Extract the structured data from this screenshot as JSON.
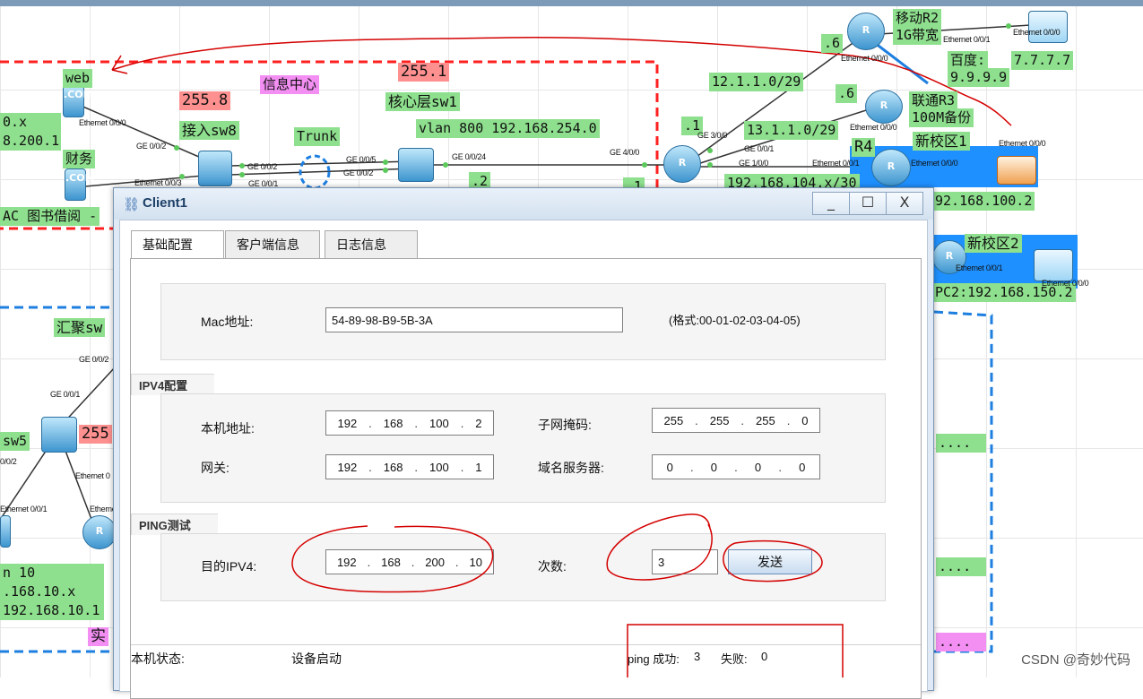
{
  "topology": {
    "labels": {
      "web": "web",
      "caiwu": "财务",
      "ip_left_1": "0.x",
      "ip_left_2": "8.200.1",
      "mask_255_8": "255.8",
      "access_sw8": "接入sw8",
      "trunk": "Trunk",
      "info_center": "信息中心",
      "mask_255_1": "255.1",
      "core_sw1": "核心层sw1",
      "vlan800": "vlan 800 192.168.254.0",
      "net_12": "12.1.1.0/29",
      "net_13": "13.1.1.0/29",
      "dot6_a": ".6",
      "dot6_b": ".6",
      "dot1_a": ".1",
      "dot1_b": ".1",
      "dot2": ".2",
      "net_104": "192.168.104.x/30",
      "mobile_r2": "移动R2",
      "bw_1g": "1G带宽",
      "baidu": "百度:",
      "ip_9999": "9.9.9.9",
      "ip_7777": "7.7.7.7",
      "unicom_r3": "联通R3",
      "backup_100m": "100M备份",
      "r4": "R4",
      "campus1": "新校区1",
      "ip_100_2": "92.168.100.2",
      "campus2": "新校区2",
      "pc2_ip": "PC2:192.168.150.2",
      "library": "AC 图书借阅 -",
      "huiju_sw": "汇聚sw",
      "sw5": "sw5",
      "mask_255_left": "255",
      "vlan10": "n 10",
      "net_10x": ".168.10.x",
      "gw_10_1": "192.168.10.1",
      "shi": "实",
      "dots1": "....",
      "dots2": "....",
      "dots3": "...."
    },
    "ports": {
      "eth000_web": "Ethernet 0/0/0",
      "ge002_a": "GE 0/0/2",
      "eth003": "Ethernet 0/0/3",
      "ge002_b": "GE 0/0/2",
      "ge001_a": "GE 0/0/1",
      "ge005": "GE 0/0/5",
      "ge002_c": "GE 0/0/2",
      "ge0024": "GE 0/0/24",
      "ge400": "GE 4/0/0",
      "ge300": "GE 3/0/0",
      "ge001_b": "GE 0/0/1",
      "ge100": "GE 1/0/0",
      "eth000_r2": "Ethernet 0/0/0",
      "eth001_r2": "Ethernet 0/0/1",
      "eth000_server": "Ethernet 0/0/0",
      "eth000_r3": "Ethernet 0/0/0",
      "eth001_r4": "Ethernet 0/0/1",
      "eth000_r4": "Ethernet 0/0/0",
      "eth000_pc1": "Ethernet 0/0/0",
      "eth001_c2": "Ethernet 0/0/1",
      "eth000_c2": "Ethernet 0/0/0",
      "ge002_sw": "GE 0/0/2",
      "ge001_sw": "GE 0/0/1",
      "eth002_sw5": "0/0/2",
      "eth_sw5": "Ethernet 0",
      "eth001_sw5": "Ethernet 0/0/1",
      "eth_r_left": "Etherne"
    }
  },
  "dialog": {
    "title": "Client1",
    "buttons": {
      "minimize": "_",
      "maximize": "☐",
      "close": "X"
    },
    "tabs": [
      "基础配置",
      "客户端信息",
      "日志信息"
    ],
    "mac": {
      "label": "Mac地址:",
      "value": "54-89-98-B9-5B-3A",
      "hint": "(格式:00-01-02-03-04-05)"
    },
    "ipv4": {
      "title": "IPV4配置",
      "local_label": "本机地址:",
      "local_ip": [
        "192",
        "168",
        "100",
        "2"
      ],
      "mask_label": "子网掩码:",
      "mask": [
        "255",
        "255",
        "255",
        "0"
      ],
      "gateway_label": "网关:",
      "gateway": [
        "192",
        "168",
        "100",
        "1"
      ],
      "dns_label": "域名服务器:",
      "dns": [
        "0",
        "0",
        "0",
        "0"
      ]
    },
    "ping": {
      "title": "PING测试",
      "dest_label": "目的IPV4:",
      "dest_ip": [
        "192",
        "168",
        "200",
        "10"
      ],
      "count_label": "次数:",
      "count": "3",
      "send_label": "发送"
    },
    "status": {
      "label": "本机状态:",
      "value": "设备启动",
      "ping_success_label": "ping 成功:",
      "ping_success": "3",
      "fail_label": "失败:",
      "fail": "0"
    }
  },
  "watermark": "CSDN @奇妙代码",
  "colors": {
    "label_green": "#8ee08e",
    "label_pink": "#ff9090",
    "label_magenta": "#f38ff3",
    "annotation_red": "#d40000",
    "zone_red": "#ff2020",
    "zone_blue": "#1e7fe0",
    "campus_blue": "#1e90ff"
  }
}
